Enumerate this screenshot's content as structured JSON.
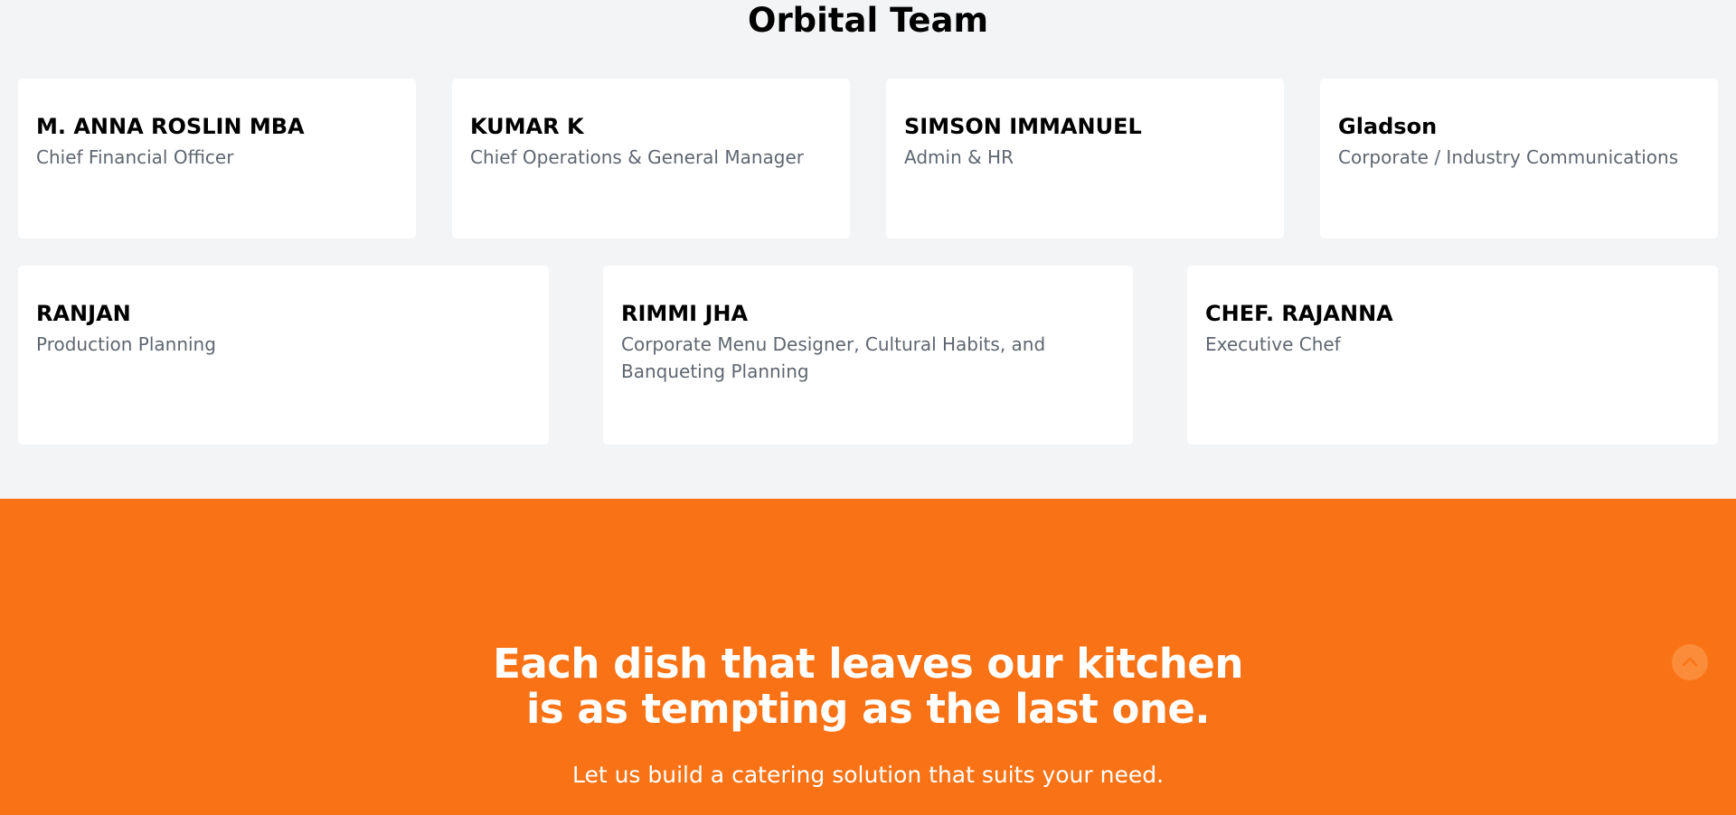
{
  "team": {
    "title": "Orbital Team",
    "members": [
      {
        "name": "M. ANNA ROSLIN MBA",
        "role": "Chief Financial Officer"
      },
      {
        "name": "KUMAR K",
        "role": "Chief Operations & General Manager"
      },
      {
        "name": "SIMSON IMMANUEL",
        "role": "Admin & HR"
      },
      {
        "name": "Gladson",
        "role": "Corporate / Industry Communications"
      },
      {
        "name": "RANJAN",
        "role": "Production Planning"
      },
      {
        "name": "RIMMI JHA",
        "role": "Corporate Menu Designer, Cultural Habits, and Banqueting Planning"
      },
      {
        "name": "CHEF. RAJANNA",
        "role": "Executive Chef"
      }
    ]
  },
  "cta": {
    "heading_line1": "Each dish that leaves our kitchen",
    "heading_line2": "is as tempting as the last one.",
    "subtext": "Let us build a catering solution that suits your need."
  },
  "scroll_top": {
    "icon": "chevron-up-icon"
  },
  "colors": {
    "accent": "#f97316",
    "background": "#f3f4f6",
    "card": "#ffffff",
    "role_text": "#5f6670"
  }
}
